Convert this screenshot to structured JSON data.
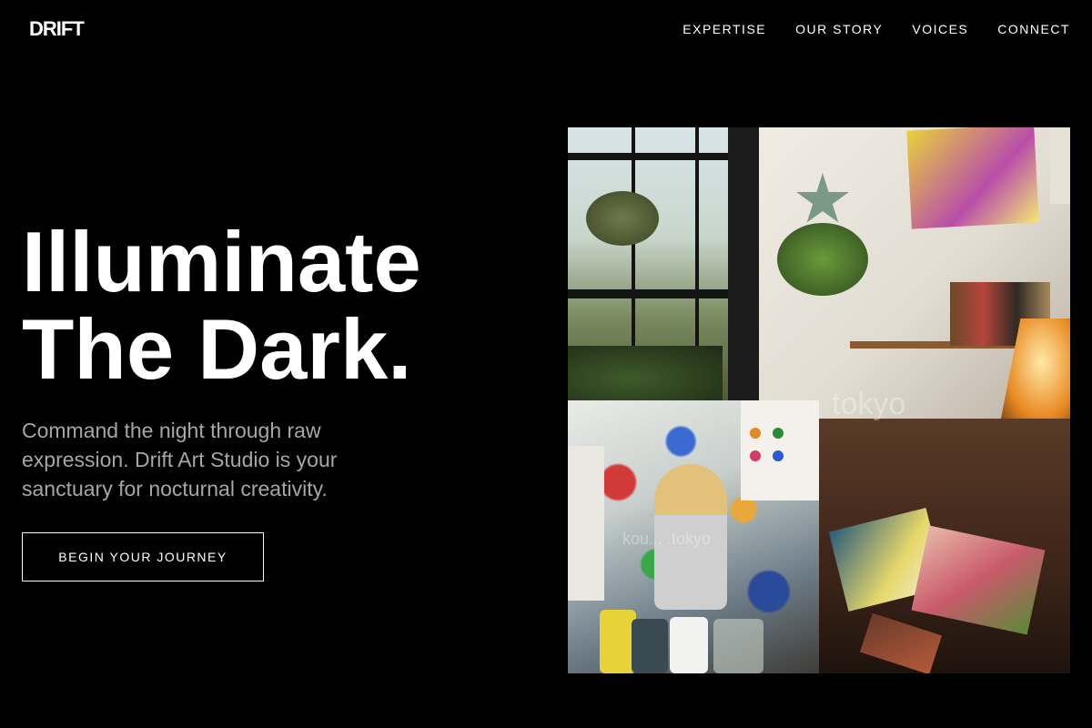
{
  "nav": {
    "logo": "DRIFT",
    "links": [
      "EXPERTISE",
      "OUR STORY",
      "VOICES",
      "CONNECT"
    ]
  },
  "hero": {
    "title_line1": "Illuminate",
    "title_line2": "The Dark.",
    "subtitle": "Command the night through raw expression. Drift Art Studio is your sanctuary for nocturnal creativity.",
    "cta_label": "BEGIN YOUR JOURNEY"
  },
  "collage": {
    "watermark_large": "tokyo",
    "watermark_small": "kou... .tokyo"
  },
  "colors": {
    "background": "#000000",
    "text": "#ffffff",
    "subtitle": "#a6a6a6"
  }
}
